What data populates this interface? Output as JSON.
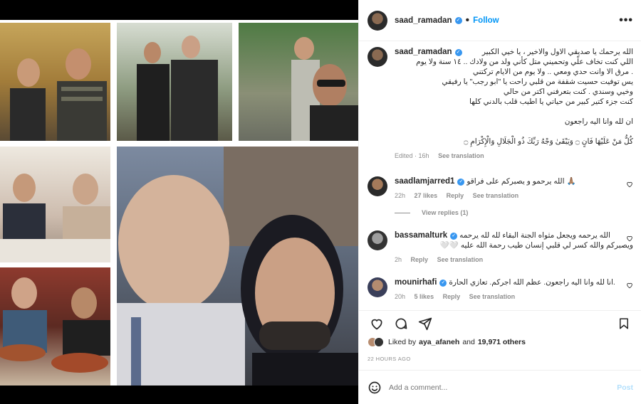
{
  "post_header": {
    "username": "saad_ramadan",
    "dot": "•",
    "follow": "Follow",
    "more": "•••",
    "verified": "✓"
  },
  "caption": {
    "username": "saad_ramadan",
    "lines": [
      "الله يرحمك يا صديقي الاول والاخير ، يا خيي الكبير",
      "اللي كنت تخاف علّي وتحميني متل كأني ولد من ولادك .. ١٤ سنة ولا يوم",
      ". مرق الا وانت حدي ومعي .. ولا يوم من الايام تركتني",
      "يس توفيت حسيت شقفة من قلبي راحت يا \"ابو رجب\" يا رفيقي",
      "وخيي وسندي . كنت بتعرفني اكتر من حالي",
      "كنت جزء كتير كبير من حياتي يا اطيب قلب بالدني كلها",
      "ان لله وانا اليه راجعون",
      "كُلُّ مَنْ عَلَيْهَا فَانٍ ۝ وَيَبْقَىٰ وَجْهُ رَبِّكَ ذُو الْجَلَالِ وَالْإِكْرَامِ ۝"
    ],
    "edited": "Edited · 16h",
    "see_translation": "See translation"
  },
  "comments": [
    {
      "username": "saadlamjarred1",
      "verified": true,
      "text": "الله يرحمو و يصبركم على فراقو 🙏🏽",
      "time": "22h",
      "likes": "27 likes",
      "reply": "Reply",
      "translate": "See translation"
    },
    {
      "username": "bassamalturk",
      "verified": true,
      "text": "الله يرحمه ويجعل مثواه الجنة البقاء لله لله يرحمه",
      "text2": "ويصبركم والله كسر لي قلبي إنسان طيب رحمة الله عليه 🤍🤍",
      "time": "2h",
      "reply": "Reply",
      "translate": "See translation"
    },
    {
      "username": "mounirhafi",
      "verified": true,
      "text": "انا لله وانا اليه راجعون. عظم الله اجركم. تعازي الحارة.",
      "time": "20h",
      "likes": "5 likes",
      "reply": "Reply",
      "translate": "See translation"
    }
  ],
  "view_replies": "View replies (1)",
  "likes": {
    "prefix": "Liked by",
    "user": "aya_afaneh",
    "and": "and",
    "count": "19,971 others"
  },
  "timestamp": "22 HOURS AGO",
  "add_comment": {
    "placeholder": "Add a comment...",
    "post": "Post"
  }
}
